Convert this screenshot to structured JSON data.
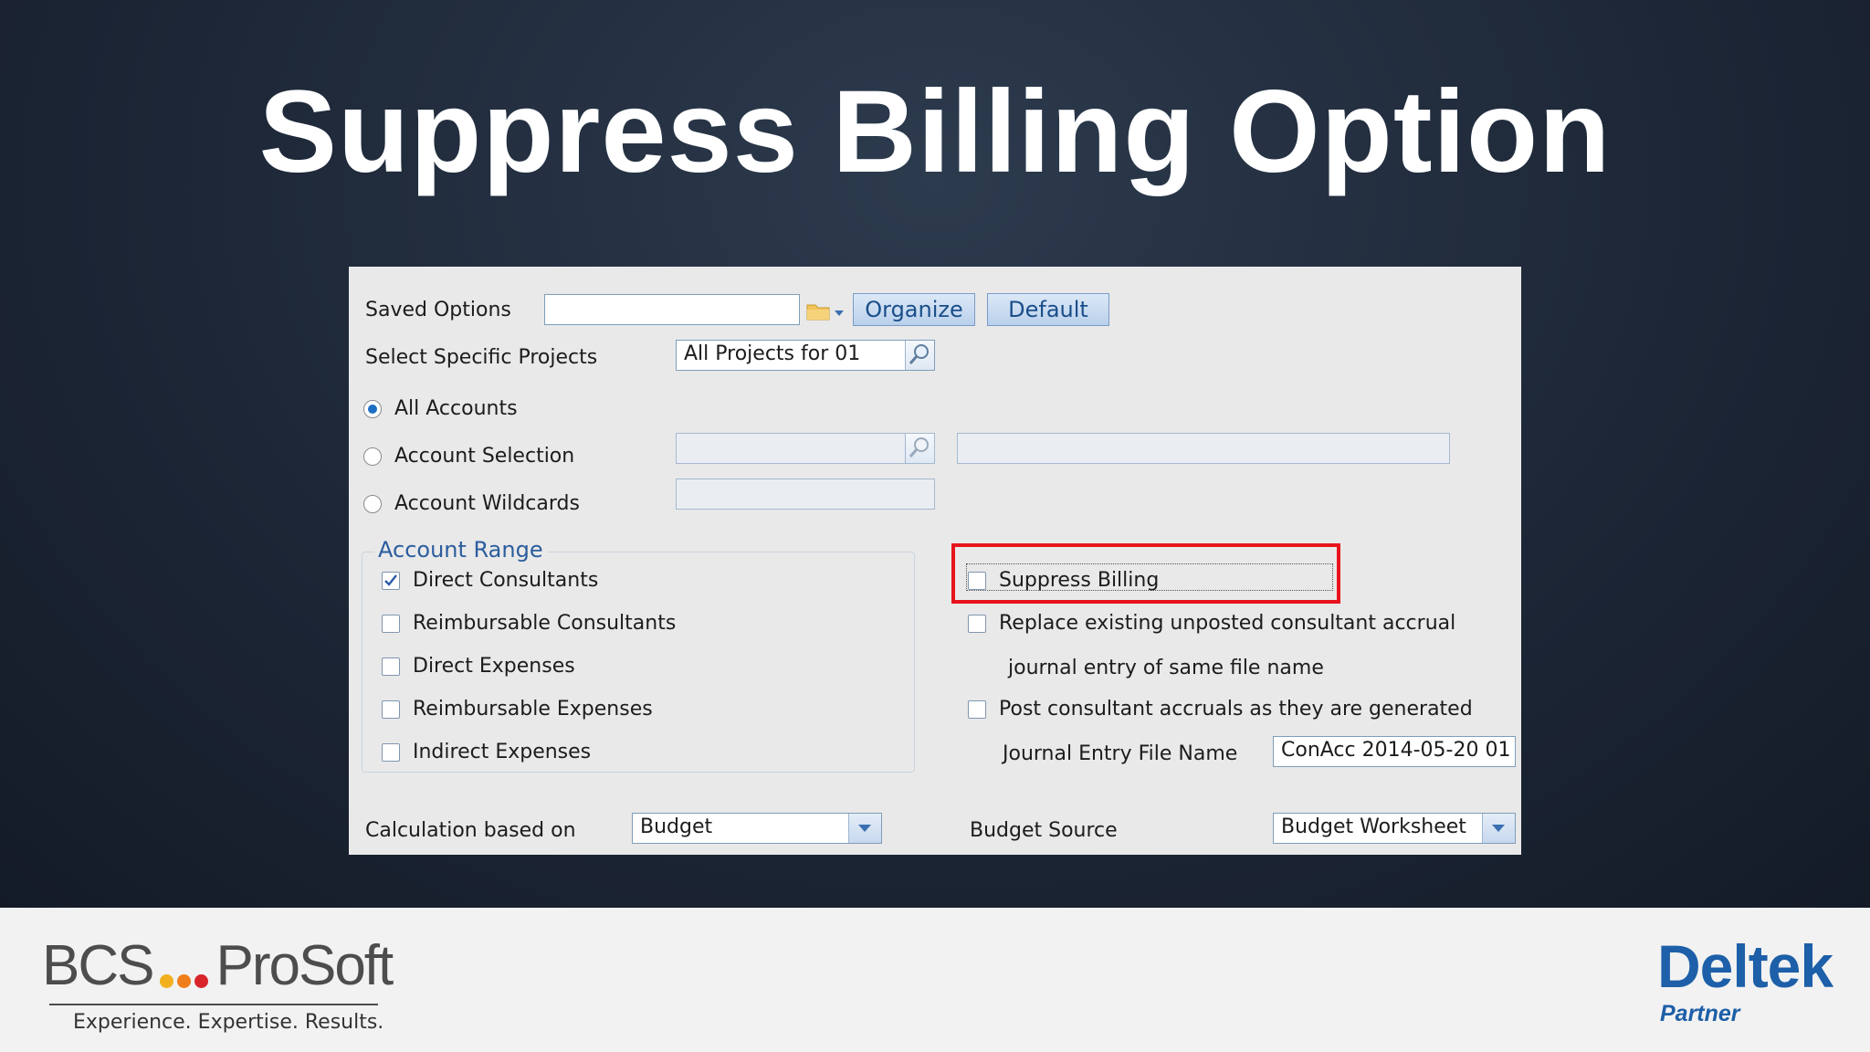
{
  "slide": {
    "title": "Suppress Billing Option"
  },
  "form": {
    "saved_options": {
      "label": "Saved Options",
      "value": "",
      "organize_button": "Organize",
      "default_button": "Default"
    },
    "select_projects": {
      "label": "Select Specific Projects",
      "value": "All Projects for 01"
    },
    "account_mode": {
      "all_accounts": {
        "label": "All Accounts",
        "selected": true
      },
      "account_selection": {
        "label": "Account Selection",
        "selected": false
      },
      "account_wildcards": {
        "label": "Account Wildcards",
        "selected": false
      }
    },
    "account_range": {
      "title": "Account Range",
      "items": [
        {
          "label": "Direct Consultants",
          "checked": true
        },
        {
          "label": "Reimbursable Consultants",
          "checked": false
        },
        {
          "label": "Direct Expenses",
          "checked": false
        },
        {
          "label": "Reimbursable Expenses",
          "checked": false
        },
        {
          "label": "Indirect Expenses",
          "checked": false
        }
      ]
    },
    "options": {
      "suppress_billing": {
        "label": "Suppress Billing",
        "checked": false
      },
      "replace_existing": {
        "label_line1": "Replace existing unposted consultant accrual",
        "label_line2": "journal entry of same file name",
        "checked": false
      },
      "post_accruals": {
        "label": "Post consultant accruals as they are generated",
        "checked": false
      },
      "journal_entry_file": {
        "label": "Journal Entry File Name",
        "value": "ConAcc 2014-05-20 01"
      }
    },
    "calculation": {
      "label": "Calculation based on",
      "value": "Budget"
    },
    "budget_source": {
      "label": "Budget Source",
      "value": "Budget Worksheet"
    }
  },
  "footer": {
    "bcs_left": "BCS",
    "bcs_right": "ProSoft",
    "bcs_tagline": "Experience. Expertise. Results.",
    "deltek": "Deltek",
    "deltek_sub": "Partner"
  },
  "colors": {
    "highlight": "#e8141c",
    "link_blue": "#2b5d9e",
    "deltek_blue": "#1d5fa8",
    "dot_yellow": "#f2b01e",
    "dot_orange": "#ef7d1a",
    "dot_red": "#d9252a"
  }
}
